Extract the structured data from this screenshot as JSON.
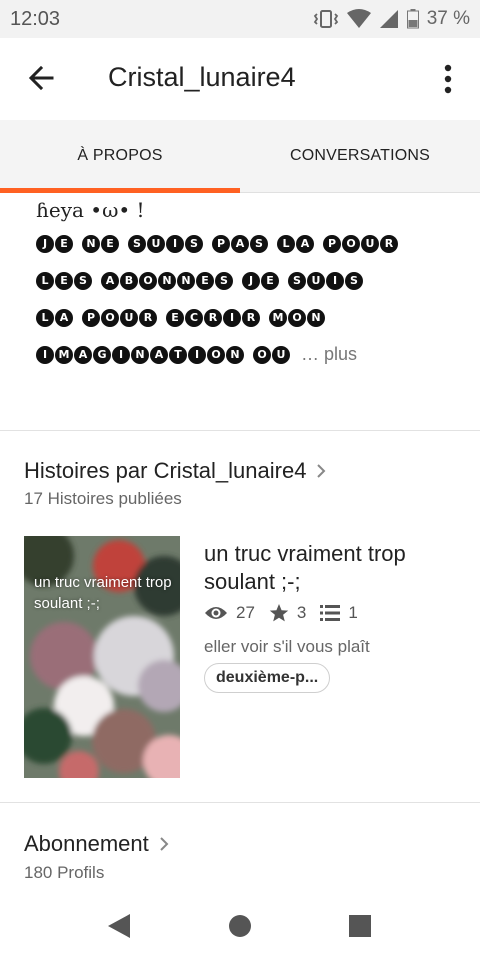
{
  "status": {
    "time": "12:03",
    "battery": "37 %"
  },
  "appbar": {
    "title": "Cristal_lunaire4"
  },
  "tabs": [
    {
      "label": "À PROPOS",
      "active": true
    },
    {
      "label": "CONVERSATIONS",
      "active": false
    }
  ],
  "about": {
    "heya": "ɦeya •ω• !",
    "lines": [
      [
        "JE",
        "NE",
        "SUIS",
        "PAS",
        "LA",
        "POUR"
      ],
      [
        "LES",
        "ABONNES",
        "JE",
        "SUIS"
      ],
      [
        "LA",
        "POUR",
        "ECRIR",
        "MON"
      ],
      [
        "IMAGINATION",
        "OU"
      ]
    ],
    "more": "… plus"
  },
  "stories_section": {
    "title": "Histoires par Cristal_lunaire4",
    "subtitle": "17 Histoires publiées"
  },
  "story": {
    "cover_text": "un truc vraiment trop soulant ;-;",
    "title": "un truc vraiment trop soulant ;-;",
    "reads": "27",
    "votes": "3",
    "parts": "1",
    "description": "eller voir s'il vous plaît",
    "tag": "deuxième-p..."
  },
  "following": {
    "title": "Abonnement",
    "subtitle": "180 Profils"
  },
  "colors": {
    "accent": "#ff6122",
    "status_bg": "#f2f2f2",
    "tab_bg": "#f4f4f4"
  },
  "icons": {
    "back": "arrow-left-icon",
    "menu": "more-vertical-icon",
    "reads": "eye-icon",
    "votes": "star-icon",
    "parts": "list-icon",
    "nav_back": "triangle-back-icon",
    "nav_home": "circle-home-icon",
    "nav_recent": "square-recent-icon"
  }
}
